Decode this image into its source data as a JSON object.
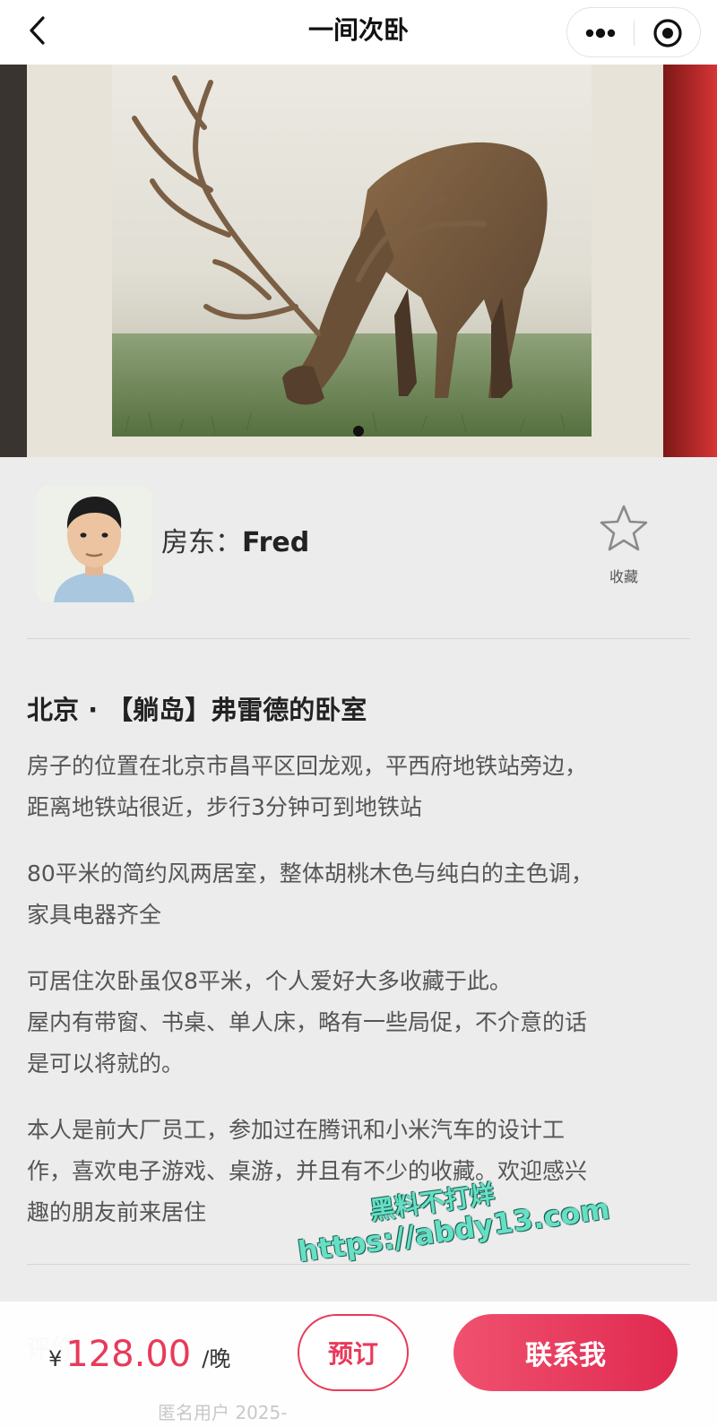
{
  "nav": {
    "title": "一间次卧",
    "back_icon": "chevron-left-icon",
    "more_icon": "more-dots-icon",
    "close_icon": "target-close-icon"
  },
  "carousel": {
    "image": "deer-grazing-photo",
    "dot_count": 1,
    "active_index": 0
  },
  "host": {
    "label": "房东：",
    "name": "Fred",
    "favorite_label": "收藏"
  },
  "listing": {
    "title": "北京 · 【躺岛】弗雷德的卧室",
    "paragraphs": [
      [
        "房子的位置在北京市昌平区回龙观，平西府地铁站旁边，",
        "距离地铁站很近，步行3分钟可到地铁站"
      ],
      [
        "80平米的简约风两居室，整体胡桃木色与纯白的主色调，",
        "家具电器齐全"
      ],
      [
        "可居住次卧虽仅8平米，个人爱好大多收藏于此。",
        "屋内有带窗、书桌、单人床，略有一些局促，不介意的话",
        "是可以将就的。"
      ],
      [
        "本人是前大厂员工，参加过在腾讯和小米汽车的设计工",
        "作，喜欢电子游戏、桌游，并且有不少的收藏。欢迎感兴",
        "趣的朋友前来居住"
      ]
    ]
  },
  "watermark": {
    "line1": "黑料不打烊",
    "line2": "https://abdy13.com"
  },
  "reviews": {
    "title": "评价",
    "user_preview": "匿名用户 2025-"
  },
  "booking": {
    "currency": "¥",
    "price": "128.00",
    "unit": "/晚",
    "book_label": "预订",
    "contact_label": "联系我"
  },
  "colors": {
    "accent": "#e83a5a",
    "background": "#ececec"
  }
}
